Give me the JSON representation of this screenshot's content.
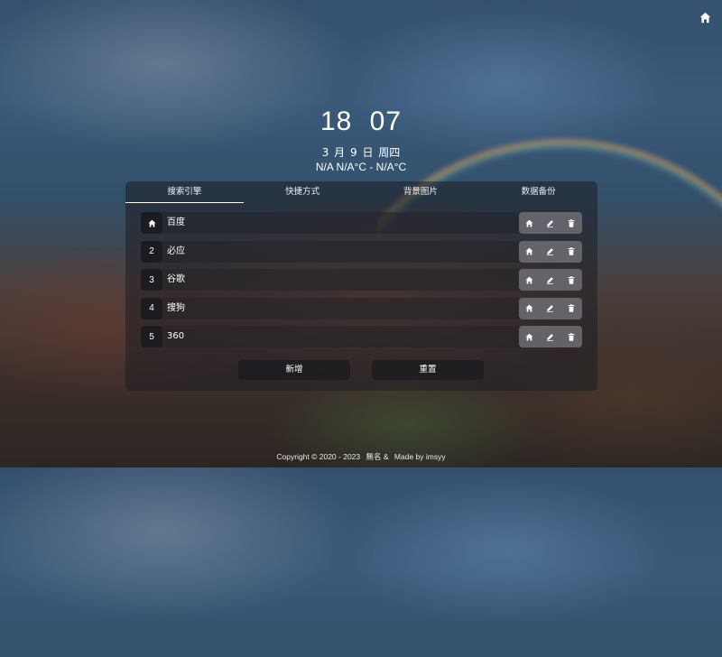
{
  "clock": {
    "hour": "18",
    "minute": "07"
  },
  "date_text": "3 月 9 日 周四",
  "weather_text": "N/A N/A°C - N/A°C",
  "tabs": [
    {
      "label": "搜索引擎",
      "active": true
    },
    {
      "label": "快捷方式",
      "active": false
    },
    {
      "label": "背景图片",
      "active": false
    },
    {
      "label": "数据备份",
      "active": false
    }
  ],
  "engines": [
    {
      "num": "home-icon",
      "name": "百度"
    },
    {
      "num": "2",
      "name": "必应"
    },
    {
      "num": "3",
      "name": "谷歌"
    },
    {
      "num": "4",
      "name": "搜狗"
    },
    {
      "num": "5",
      "name": "360"
    }
  ],
  "buttons": {
    "add": "新增",
    "reset": "重置"
  },
  "footer": {
    "copyright": "Copyright © 2020 - 2023",
    "author": "無名 &",
    "made_by": "Made by imsyy"
  },
  "icons": {
    "top_right": "home-icon",
    "row_actions": [
      "home-icon",
      "edit-icon",
      "trash-icon"
    ]
  }
}
